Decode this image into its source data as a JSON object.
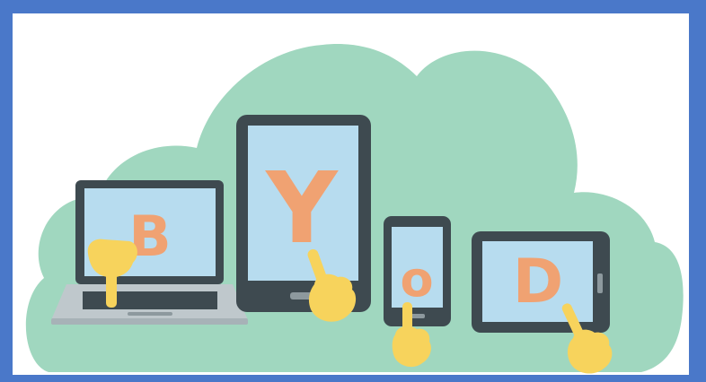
{
  "colors": {
    "border": "#4a78c9",
    "panel": "#ffffff",
    "cloud": "#a0d7bf",
    "device_frame": "#3e4a50",
    "screen": "#b7dcef",
    "letter": "#f0a272",
    "hand": "#f7d35c",
    "laptop_base": "#bfc8cc"
  },
  "icons": {
    "cloud": "cloud-icon",
    "laptop": "laptop-icon",
    "tablet": "tablet-icon",
    "phone": "smartphone-icon",
    "hand": "pointing-hand-icon"
  },
  "letters": {
    "b": "B",
    "y": "Y",
    "o": "o",
    "d": "D"
  }
}
